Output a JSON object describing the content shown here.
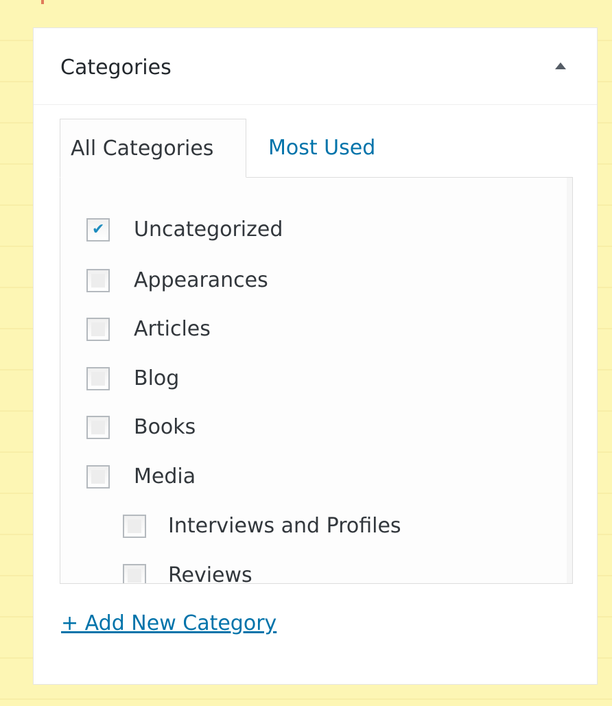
{
  "panel": {
    "title": "Categories",
    "toggle_icon": "triangle-up-icon"
  },
  "tabs": {
    "all": "All Categories",
    "most_used": "Most Used"
  },
  "categories": [
    {
      "label": "Uncategorized",
      "checked": true
    },
    {
      "label": "Appearances",
      "checked": false
    },
    {
      "label": "Articles",
      "checked": false
    },
    {
      "label": "Blog",
      "checked": false
    },
    {
      "label": "Books",
      "checked": false
    },
    {
      "label": "Media",
      "checked": false
    },
    {
      "label": "Interviews and Profiles",
      "checked": false,
      "child": true
    },
    {
      "label": "Reviews",
      "checked": false,
      "child": true
    }
  ],
  "add_new": "+ Add New Category",
  "colors": {
    "link": "#0073aa",
    "check": "#1e8cbe",
    "page_bg": "#fdf6b4"
  }
}
